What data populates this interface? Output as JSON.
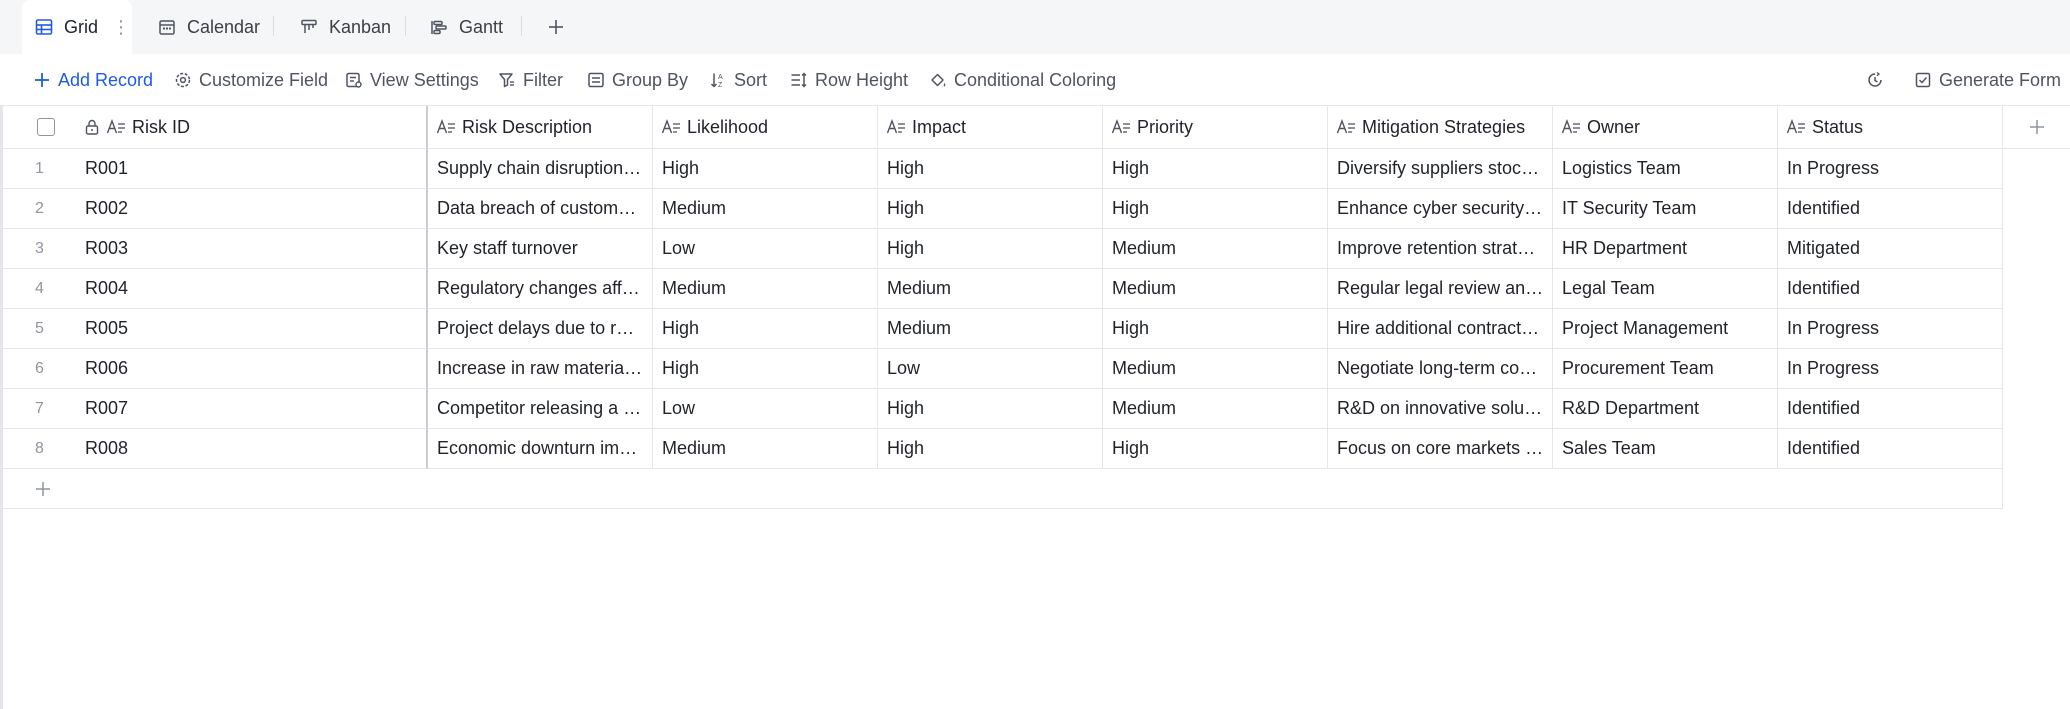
{
  "tabs": [
    {
      "label": "Grid",
      "icon": "grid-icon",
      "active": true
    },
    {
      "label": "Calendar",
      "icon": "calendar-icon",
      "active": false
    },
    {
      "label": "Kanban",
      "icon": "kanban-icon",
      "active": false
    },
    {
      "label": "Gantt",
      "icon": "gantt-icon",
      "active": false
    }
  ],
  "toolbar": {
    "add_record": "Add Record",
    "customize_field": "Customize Field",
    "view_settings": "View Settings",
    "filter": "Filter",
    "group_by": "Group By",
    "sort": "Sort",
    "row_height": "Row Height",
    "conditional_coloring": "Conditional Coloring",
    "generate_form": "Generate Form"
  },
  "columns": [
    "Risk ID",
    "Risk Description",
    "Likelihood",
    "Impact",
    "Priority",
    "Mitigation Strategies",
    "Owner",
    "Status"
  ],
  "rows": [
    {
      "num": "1",
      "cells": [
        "R001",
        "Supply chain disruption due to natural disasters",
        "High",
        "High",
        "High",
        "Diversify suppliers stockpile critical materials",
        "Logistics Team",
        "In Progress"
      ]
    },
    {
      "num": "2",
      "cells": [
        "R002",
        "Data breach of customer information",
        "Medium",
        "High",
        "High",
        "Enhance cyber security measures",
        "IT Security Team",
        "Identified"
      ]
    },
    {
      "num": "3",
      "cells": [
        "R003",
        "Key staff turnover",
        "Low",
        "High",
        "Medium",
        "Improve retention strategies",
        "HR Department",
        "Mitigated"
      ]
    },
    {
      "num": "4",
      "cells": [
        "R004",
        "Regulatory changes affecting operations",
        "Medium",
        "Medium",
        "Medium",
        "Regular legal review and compliance",
        "Legal Team",
        "Identified"
      ]
    },
    {
      "num": "5",
      "cells": [
        "R005",
        "Project delays due to resource shortages",
        "High",
        "Medium",
        "High",
        "Hire additional contractors",
        "Project Management",
        "In Progress"
      ]
    },
    {
      "num": "6",
      "cells": [
        "R006",
        "Increase in raw material costs",
        "High",
        "Low",
        "Medium",
        "Negotiate long-term contracts",
        "Procurement Team",
        "In Progress"
      ]
    },
    {
      "num": "7",
      "cells": [
        "R007",
        "Competitor releasing a similar product",
        "Low",
        "High",
        "Medium",
        "R&D on innovative solutions",
        "R&D Department",
        "Identified"
      ]
    },
    {
      "num": "8",
      "cells": [
        "R008",
        "Economic downturn impacting sales",
        "Medium",
        "High",
        "High",
        "Focus on core markets and cost control",
        "Sales Team",
        "Identified"
      ]
    }
  ],
  "colors": {
    "accent": "#1f5be6",
    "border": "#e5e6eb",
    "tab_bg": "#f5f6f7"
  }
}
